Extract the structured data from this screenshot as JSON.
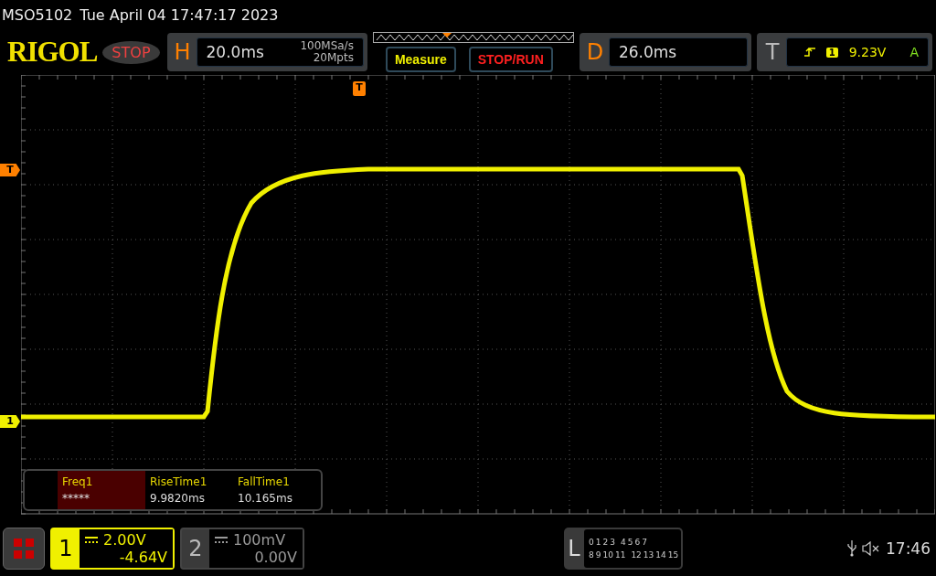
{
  "status_line": {
    "model": "MSO5102",
    "datetime": "Tue April 04 17:47:17 2023"
  },
  "logo": "RIGOL",
  "run_state": {
    "label": "STOP"
  },
  "horizontal": {
    "letter": "H",
    "timebase": "20.0ms",
    "sample_rate": "100MSa/s",
    "memory_depth": "20Mpts"
  },
  "buttons": [
    {
      "label": "Measure",
      "kind": "measure"
    },
    {
      "label": "STOP/RUN",
      "kind": "stoprun"
    }
  ],
  "delay": {
    "letter": "D",
    "value": "26.0ms"
  },
  "trigger": {
    "letter": "T",
    "source": "1",
    "level": "9.23V",
    "mode": "A"
  },
  "markers": [
    {
      "label": "T",
      "kind": "trigger_position"
    },
    {
      "label": "T",
      "kind": "trigger_level"
    },
    {
      "label": "1",
      "kind": "channel_offset"
    }
  ],
  "measurements": [
    {
      "name": "Freq1",
      "value": "*****",
      "selected": true
    },
    {
      "name": "RiseTime1",
      "value": "9.9820ms",
      "selected": false
    },
    {
      "name": "FallTime1",
      "value": "10.165ms",
      "selected": false
    }
  ],
  "channels": [
    {
      "number": "1",
      "scale": "2.00V",
      "offset": "-4.64V",
      "selected": true
    },
    {
      "number": "2",
      "scale": "100mV",
      "offset": "0.00V",
      "selected": false
    }
  ],
  "logic": {
    "letter": "L",
    "row_1": [
      "0",
      "1",
      "2",
      "3",
      "4",
      "5",
      "6",
      "7"
    ],
    "row_2": [
      "8",
      "9",
      "10",
      "11",
      "12",
      "13",
      "14",
      "15"
    ]
  },
  "clock": "17:46"
}
